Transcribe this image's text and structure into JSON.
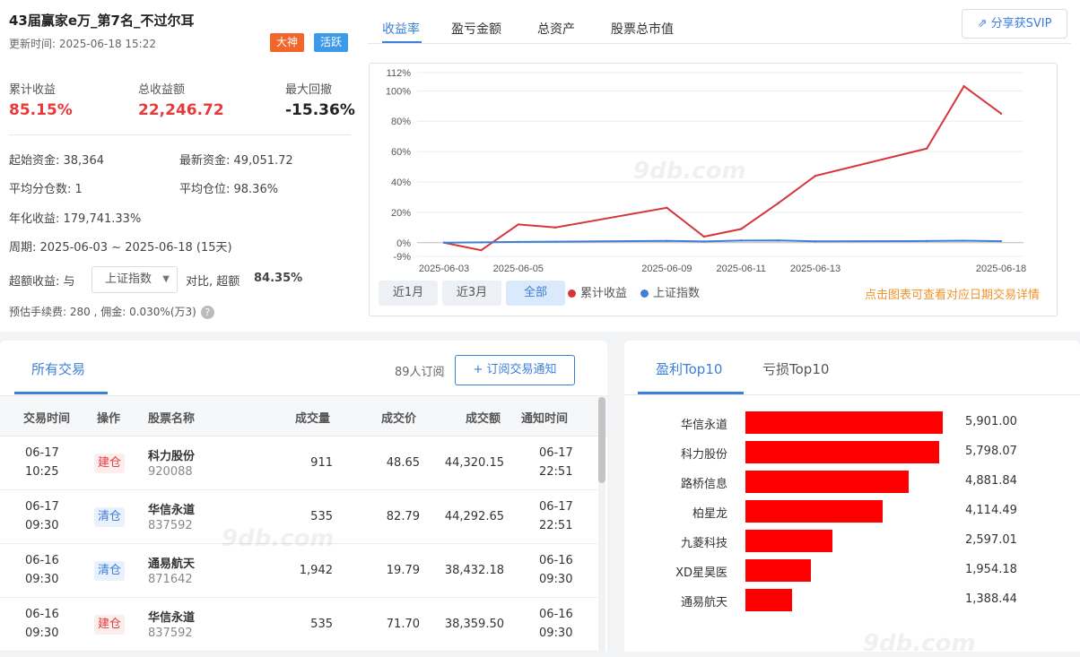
{
  "header": {
    "title": "43届赢家e万_第7名_不过尔耳",
    "updated": "更新时间: 2025-06-18 15:22",
    "badges": [
      {
        "label": "大神",
        "color": "#f2662b"
      },
      {
        "label": "活跃",
        "color": "#3d9ae8"
      }
    ]
  },
  "stats": [
    {
      "label": "累计收益",
      "value": "85.15%",
      "color": "#e5393a"
    },
    {
      "label": "总收益额",
      "value": "22,246.72",
      "color": "#e5393a"
    },
    {
      "label": "最大回撤",
      "value": "-15.36%",
      "color": "#222222"
    }
  ],
  "info": {
    "start_capital": "起始资金: 38,364",
    "latest_capital": "最新资金: 49,051.72",
    "avg_positions": "平均分仓数: 1",
    "avg_holding": "平均仓位: 98.36%",
    "annual_return": "年化收益: 179,741.33%",
    "period": "周期: 2025-06-03 ~ 2025-06-18 (15天)",
    "excess_prefix": "超额收益: 与",
    "benchmark_select": "上证指数",
    "excess_mid": "对比, 超额",
    "excess_value": "84.35%",
    "fees": "预估手续费: 280 , 佣金: 0.030%(万3)"
  },
  "chart_tabs": [
    "收益率",
    "盈亏金额",
    "总资产",
    "股票总市值"
  ],
  "share_label": "分享获SVIP",
  "range_buttons": [
    "近1月",
    "近3月",
    "全部"
  ],
  "hint": "点击图表可查看对应日期交易详情",
  "chart_data": {
    "type": "line",
    "x": [
      "2025-06-03",
      "2025-06-04",
      "2025-06-05",
      "2025-06-06",
      "2025-06-09",
      "2025-06-10",
      "2025-06-11",
      "2025-06-12",
      "2025-06-13",
      "2025-06-16",
      "2025-06-17",
      "2025-06-18"
    ],
    "series": [
      {
        "name": "累计收益",
        "color": "#d6363a",
        "values": [
          0,
          -5,
          12,
          10,
          23,
          4,
          9,
          26,
          44,
          62,
          103,
          85
        ]
      },
      {
        "name": "上证指数",
        "color": "#3f7fd6",
        "values": [
          0,
          0.2,
          0.5,
          0.7,
          1.2,
          0.8,
          1.4,
          1.5,
          0.9,
          1.1,
          1.3,
          1.0
        ]
      }
    ],
    "yticks": [
      "112%",
      "100%",
      "80%",
      "60%",
      "40%",
      "20%",
      "0%",
      "-9%"
    ],
    "ytick_values": [
      112,
      100,
      80,
      60,
      40,
      20,
      0,
      -9
    ],
    "xticks": [
      "2025-06-03",
      "2025-06-05",
      "2025-06-09",
      "2025-06-11",
      "2025-06-13",
      "2025-06-18"
    ],
    "ylim": [
      -9,
      112
    ],
    "grid": true,
    "legend": "bottom"
  },
  "trades": {
    "tab": "所有交易",
    "subscribers": "89人订阅",
    "subscribe_label": "+ 订阅交易通知",
    "columns": [
      "交易时间",
      "操作",
      "股票名称",
      "成交量",
      "成交价",
      "成交额",
      "通知时间"
    ],
    "rows": [
      {
        "date": "06-17",
        "time": "10:25",
        "op": "建仓",
        "type": "buy",
        "name": "科力股份",
        "code": "920088",
        "qty": "911",
        "price": "48.65",
        "amount": "44,320.15",
        "ndate": "06-17",
        "ntime": "22:51"
      },
      {
        "date": "06-17",
        "time": "09:30",
        "op": "清仓",
        "type": "sell",
        "name": "华信永道",
        "code": "837592",
        "qty": "535",
        "price": "82.79",
        "amount": "44,292.65",
        "ndate": "06-17",
        "ntime": "22:51"
      },
      {
        "date": "06-16",
        "time": "09:30",
        "op": "清仓",
        "type": "sell",
        "name": "通易航天",
        "code": "871642",
        "qty": "1,942",
        "price": "19.79",
        "amount": "38,432.18",
        "ndate": "06-16",
        "ntime": "09:30"
      },
      {
        "date": "06-16",
        "time": "09:30",
        "op": "建仓",
        "type": "buy",
        "name": "华信永道",
        "code": "837592",
        "qty": "535",
        "price": "71.70",
        "amount": "38,359.50",
        "ndate": "06-16",
        "ntime": "09:30"
      }
    ]
  },
  "top10": {
    "tabs": [
      "盈利Top10",
      "亏损Top10"
    ],
    "items": [
      {
        "name": "华信永道",
        "value": 5901.0,
        "label": "5,901.00"
      },
      {
        "name": "科力股份",
        "value": 5798.07,
        "label": "5,798.07"
      },
      {
        "name": "路桥信息",
        "value": 4881.84,
        "label": "4,881.84"
      },
      {
        "name": "柏星龙",
        "value": 4114.49,
        "label": "4,114.49"
      },
      {
        "name": "九菱科技",
        "value": 2597.01,
        "label": "2,597.01"
      },
      {
        "name": "XD星昊医",
        "value": 1954.18,
        "label": "1,954.18"
      },
      {
        "name": "通易航天",
        "value": 1388.44,
        "label": "1,388.44"
      }
    ]
  },
  "watermark": "9db.com"
}
